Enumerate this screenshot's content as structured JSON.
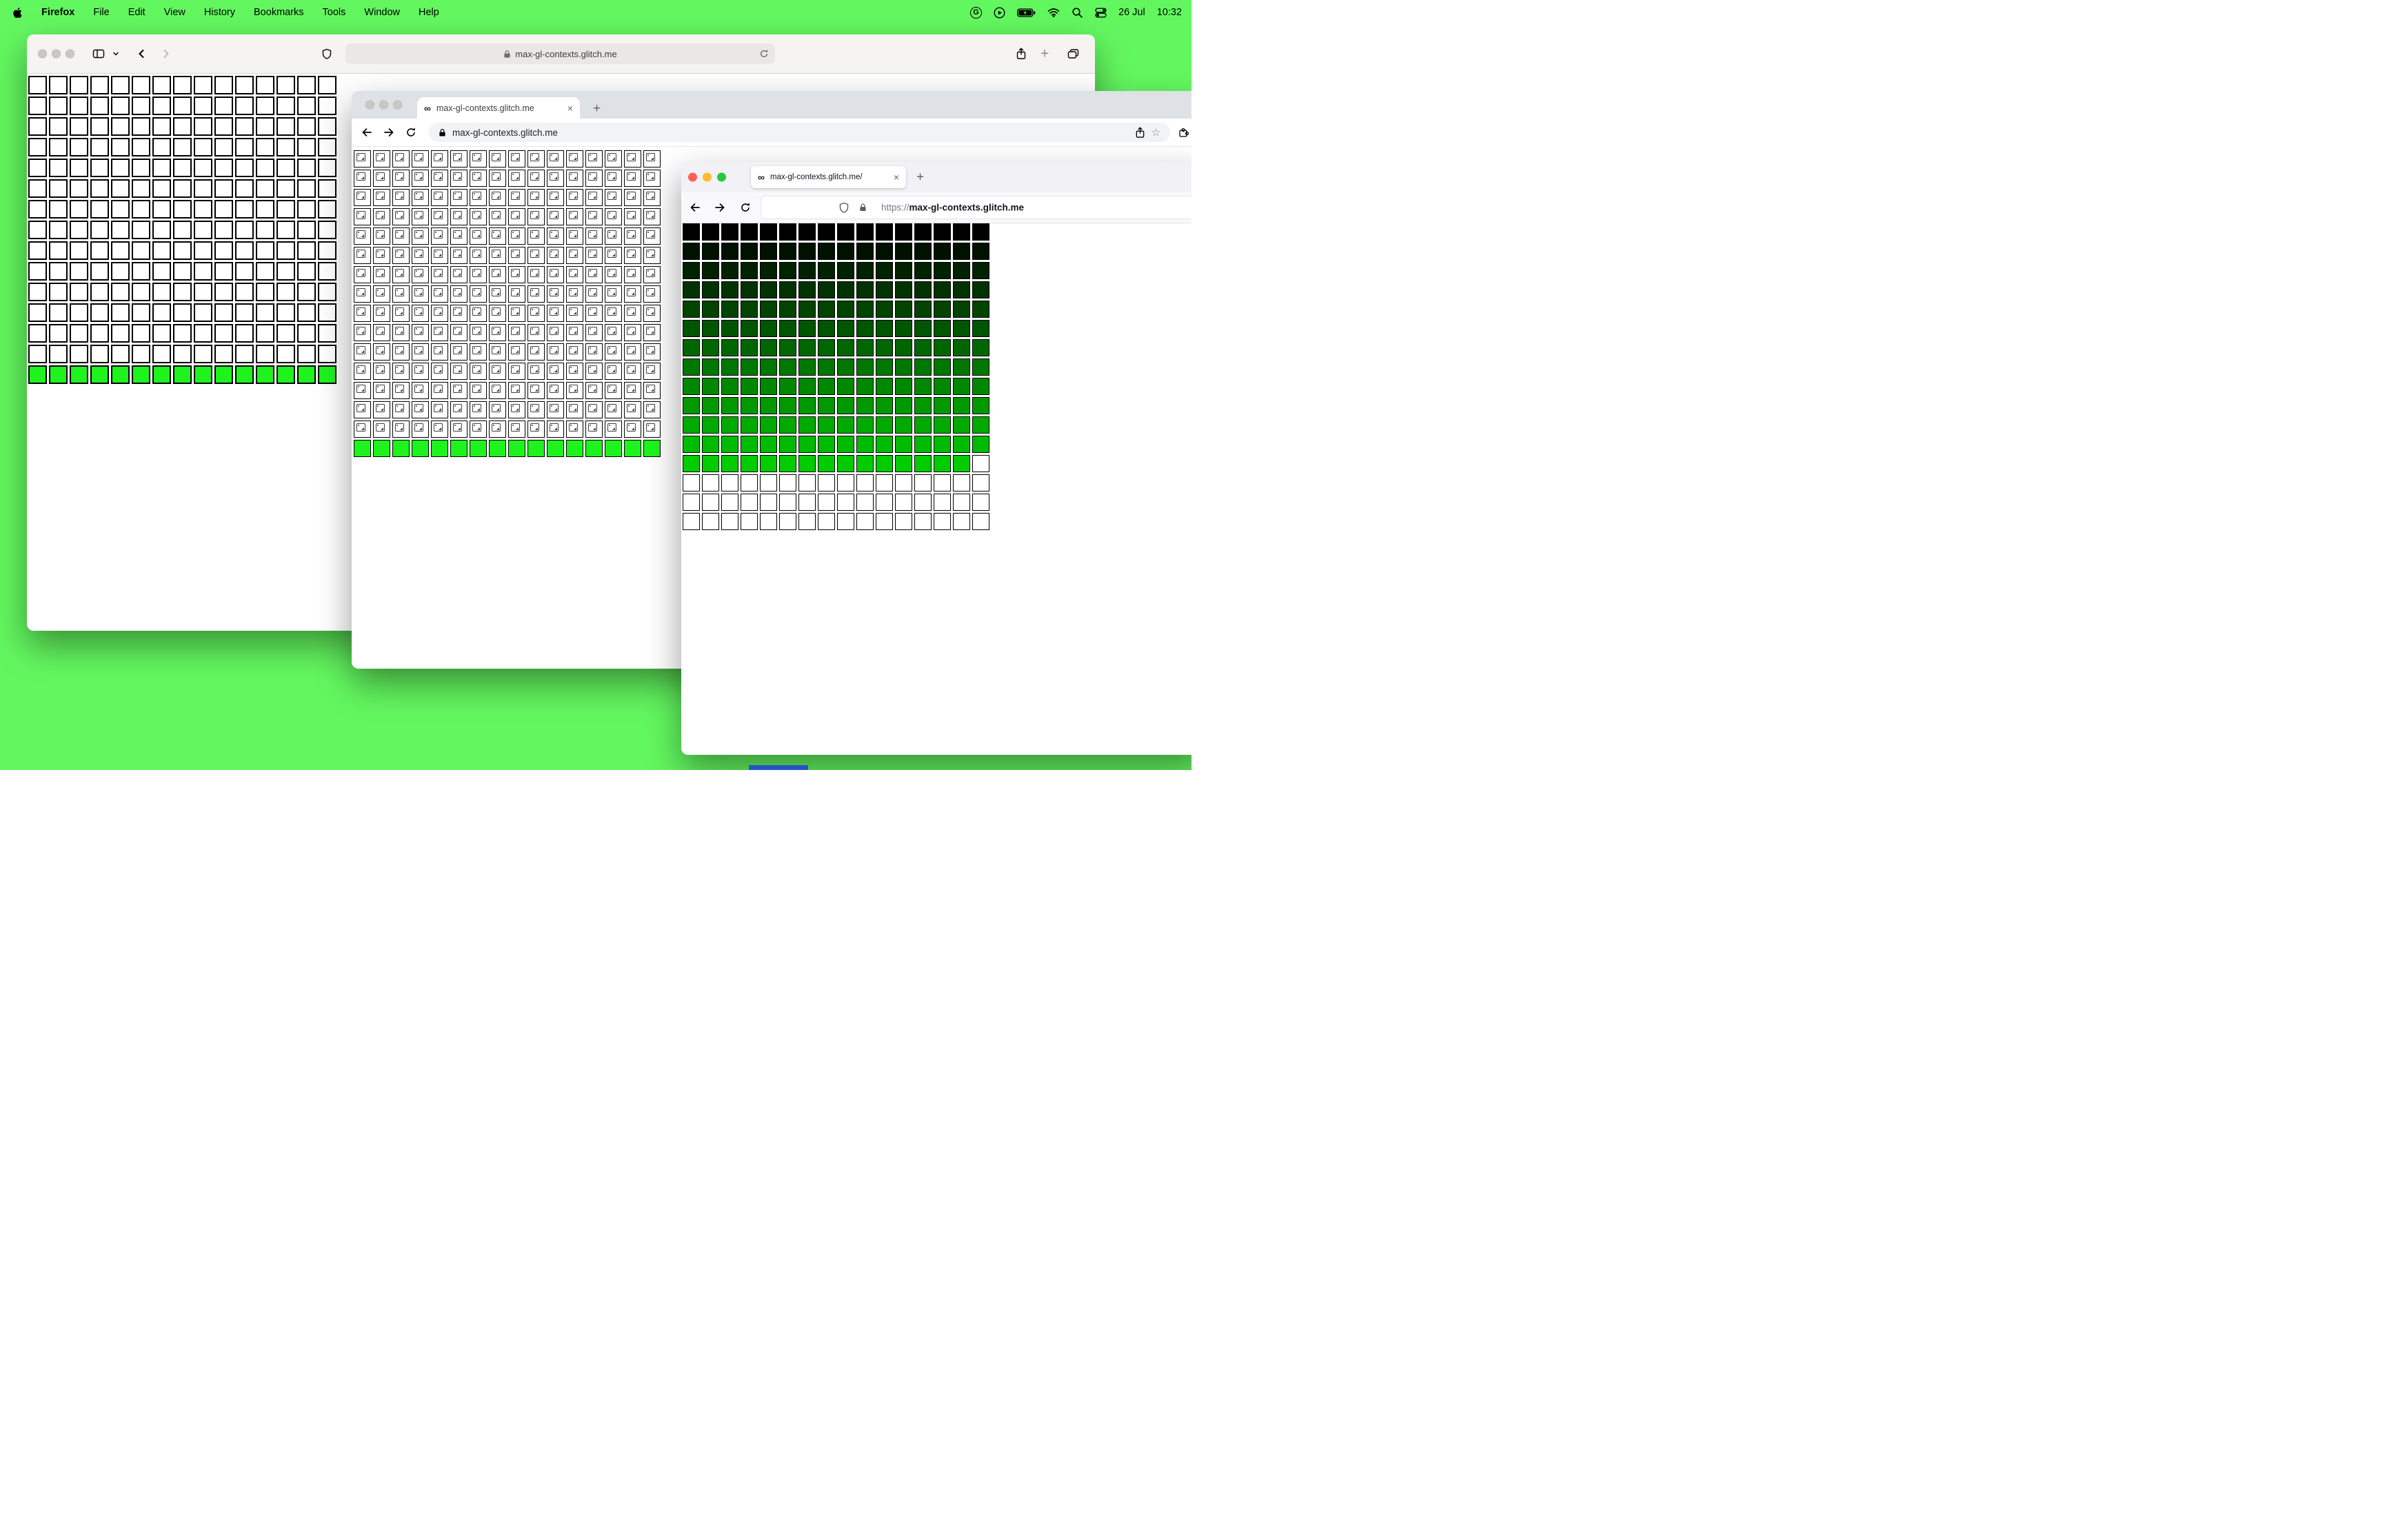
{
  "colors": {
    "desktop_green": "#63f75f",
    "lime_row": "#1ef31e",
    "firefox_grid_max_green": "#00cc00",
    "traffic_red": "#ff5f57",
    "traffic_yellow": "#febc2e",
    "traffic_green": "#28c840"
  },
  "icons": {
    "infinity": "∞",
    "close": "×",
    "new_tab_plus": "+",
    "star": "☆",
    "google_g": "G"
  },
  "menu_bar": {
    "app_name": "Firefox",
    "menus": [
      "File",
      "Edit",
      "View",
      "History",
      "Bookmarks",
      "Tools",
      "Window",
      "Help"
    ],
    "status": {
      "date": "26 Jul",
      "time": "10:32"
    }
  },
  "safari_window": {
    "url": "max-gl-contexts.glitch.me"
  },
  "chrome_window": {
    "tab_title": "max-gl-contexts.glitch.me",
    "url": "max-gl-contexts.glitch.me"
  },
  "firefox_window": {
    "tab_title": "max-gl-contexts.glitch.me/",
    "url_scheme": "https://",
    "url_host": "max-gl-contexts.glitch.me"
  },
  "grids": {
    "safari": {
      "cols": 15,
      "cell": 27,
      "gap": 3,
      "border": 2,
      "rows": [
        {
          "repeat": 14,
          "color": "#ffffff"
        },
        {
          "color": "#1ef31e"
        }
      ]
    },
    "chrome": {
      "cols": 16,
      "cell": 25,
      "gap": 3,
      "border": 1.5,
      "rows": [
        {
          "repeat": 15,
          "color": "#ffffff",
          "broken": true
        },
        {
          "color": "#1ef31e"
        }
      ]
    },
    "firefox": {
      "cols": 16,
      "cell": 25,
      "gap": 3,
      "border": 1.5,
      "rows": [
        {
          "color": "#000000"
        },
        {
          "color": "#001100"
        },
        {
          "color": "#002200"
        },
        {
          "color": "#003300"
        },
        {
          "color": "#004400"
        },
        {
          "color": "#005500"
        },
        {
          "color": "#006600"
        },
        {
          "color": "#007700"
        },
        {
          "color": "#008800"
        },
        {
          "color": "#009900"
        },
        {
          "color": "#00aa00"
        },
        {
          "color": "#00bb00"
        },
        {
          "color": "#00cc00",
          "tail_white": 1
        },
        {
          "repeat": 3,
          "color": "#ffffff"
        }
      ]
    }
  }
}
